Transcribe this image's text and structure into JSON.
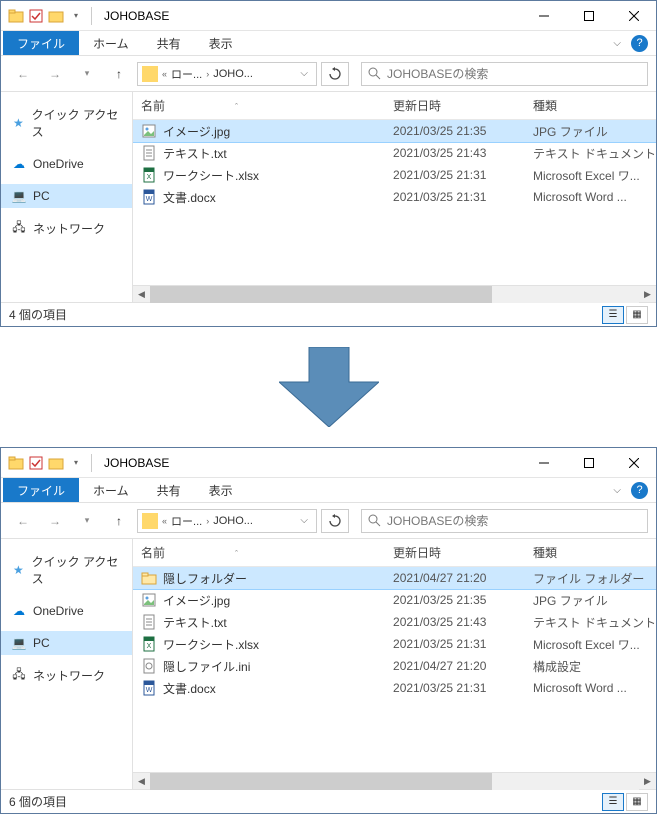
{
  "title": "JOHOBASE",
  "tabs": {
    "file": "ファイル",
    "home": "ホーム",
    "share": "共有",
    "view": "表示"
  },
  "breadcrumb": {
    "p1": "ロー...",
    "p2": "JOHO..."
  },
  "search_placeholder": "JOHOBASEの検索",
  "cols": {
    "name": "名前",
    "date": "更新日時",
    "type": "種類"
  },
  "sidebar": {
    "quick": "クイック アクセス",
    "onedrive": "OneDrive",
    "pc": "PC",
    "network": "ネットワーク"
  },
  "win1": {
    "files": [
      {
        "name": "イメージ.jpg",
        "date": "2021/03/25 21:35",
        "type": "JPG ファイル",
        "icon": "img",
        "selected": true
      },
      {
        "name": "テキスト.txt",
        "date": "2021/03/25 21:43",
        "type": "テキスト ドキュメント",
        "icon": "txt",
        "selected": false
      },
      {
        "name": "ワークシート.xlsx",
        "date": "2021/03/25 21:31",
        "type": "Microsoft Excel ワ...",
        "icon": "xls",
        "selected": false
      },
      {
        "name": "文書.docx",
        "date": "2021/03/25 21:31",
        "type": "Microsoft Word ...",
        "icon": "doc",
        "selected": false
      }
    ],
    "status": "4 個の項目"
  },
  "win2": {
    "files": [
      {
        "name": "隠しフォルダー",
        "date": "2021/04/27 21:20",
        "type": "ファイル フォルダー",
        "icon": "folder",
        "selected": true
      },
      {
        "name": "イメージ.jpg",
        "date": "2021/03/25 21:35",
        "type": "JPG ファイル",
        "icon": "img",
        "selected": false
      },
      {
        "name": "テキスト.txt",
        "date": "2021/03/25 21:43",
        "type": "テキスト ドキュメント",
        "icon": "txt",
        "selected": false
      },
      {
        "name": "ワークシート.xlsx",
        "date": "2021/03/25 21:31",
        "type": "Microsoft Excel ワ...",
        "icon": "xls",
        "selected": false
      },
      {
        "name": "隠しファイル.ini",
        "date": "2021/04/27 21:20",
        "type": "構成設定",
        "icon": "ini",
        "selected": false
      },
      {
        "name": "文書.docx",
        "date": "2021/03/25 21:31",
        "type": "Microsoft Word ...",
        "icon": "doc",
        "selected": false
      }
    ],
    "status": "6 個の項目"
  }
}
